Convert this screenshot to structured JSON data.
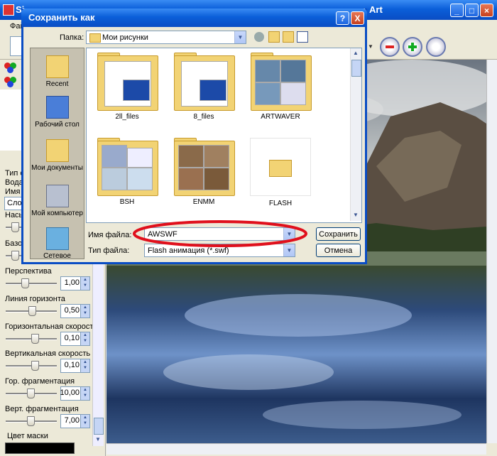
{
  "main_window": {
    "title": "Si",
    "title_tail": "Art"
  },
  "menu": {
    "first_item": "Фай"
  },
  "side_panel": {
    "partial_labels": [
      "Тип сл",
      "Вода",
      "Имя с",
      "Слой",
      "Насыщ",
      "Базов"
    ],
    "controls": [
      {
        "label": "Перспектива",
        "value": "1,00",
        "level": 0.35
      },
      {
        "label": "Линия горизонта",
        "value": "0,50",
        "level": 0.5
      },
      {
        "label": "Горизонтальная скорость",
        "value": "0,10",
        "level": 0.55
      },
      {
        "label": "Вертикальная скорость",
        "value": "0,10",
        "level": 0.55
      },
      {
        "label": "Гор. фрагментация",
        "value": "10,00",
        "level": 0.45
      },
      {
        "label": "Верт. фрагментация",
        "value": "7,00",
        "level": 0.45
      }
    ],
    "mask_label": "Цвет маски",
    "mask_color": "#000000"
  },
  "dialog": {
    "title": "Сохранить как",
    "folder_label": "Папка:",
    "folder_value": "Мои рисунки",
    "places": [
      {
        "label": "Recent",
        "icon": "recent-folder-icon"
      },
      {
        "label": "Рабочий стол",
        "icon": "desktop-icon"
      },
      {
        "label": "Мои документы",
        "icon": "my-documents-icon"
      },
      {
        "label": "Мой компьютер",
        "icon": "my-computer-icon"
      },
      {
        "label": "Сетевое",
        "icon": "network-icon"
      }
    ],
    "files": [
      {
        "name": "2ll_files"
      },
      {
        "name": "8_files"
      },
      {
        "name": "ARTWAVER"
      },
      {
        "name": "BSH"
      },
      {
        "name": "ENMM"
      },
      {
        "name": "FLASH"
      }
    ],
    "filename_label": "Имя файла:",
    "filename_value": "AWSWF",
    "filetype_label": "Тип файла:",
    "filetype_value": "Flash анимация (*.swf)",
    "save_button": "Сохранить",
    "cancel_button": "Отмена",
    "help_button": "?",
    "close_button": "X"
  },
  "colors": {
    "titlebar": "#0b5fd9",
    "highlight_ellipse": "#e0101c",
    "folder_yellow": "#f2d374"
  }
}
